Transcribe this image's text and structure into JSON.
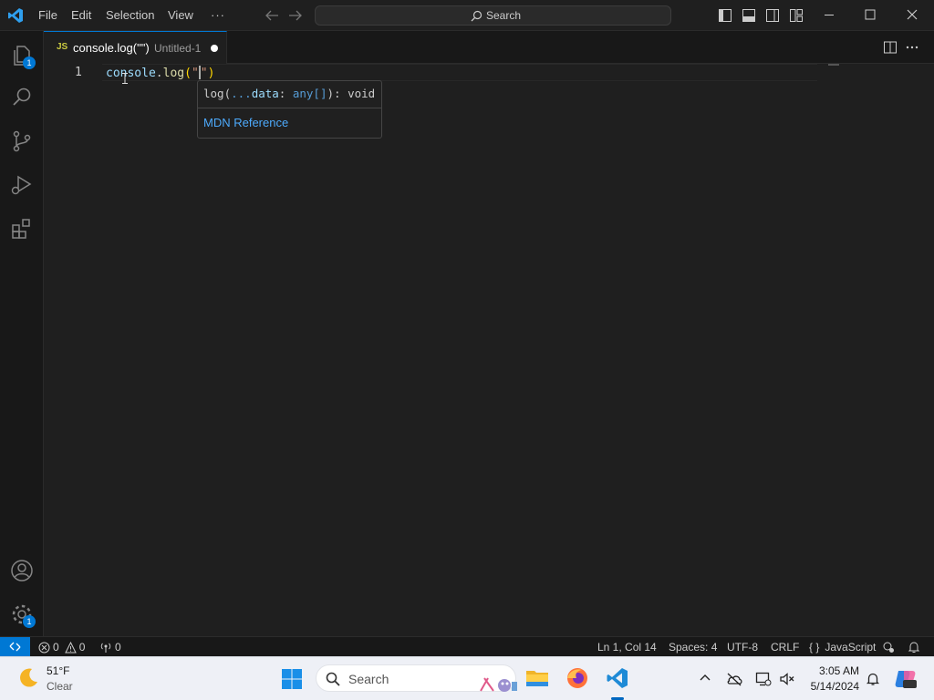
{
  "titlebar": {
    "menus": [
      "File",
      "Edit",
      "Selection",
      "View"
    ],
    "overflow": "···",
    "search_label": "Search"
  },
  "activitybar": {
    "explorer_badge": "1",
    "settings_badge": "1"
  },
  "tab": {
    "icon_label": "JS",
    "title": "console.log(\"\")",
    "description": "Untitled-1"
  },
  "editor": {
    "line_number": "1",
    "code": {
      "obj": "console",
      "dot": ".",
      "fn": "log",
      "open": "(",
      "q1": "\"",
      "q2": "\"",
      "close": ")"
    }
  },
  "hover": {
    "sig_name": "log(",
    "sig_dots": "...",
    "sig_param": "data",
    "sig_colon": ": ",
    "sig_type": "any[]",
    "sig_end": "): void",
    "link": "MDN Reference"
  },
  "statusbar": {
    "errors": "0",
    "warnings": "0",
    "ports": "0",
    "position": "Ln 1, Col 14",
    "spaces": "Spaces: 4",
    "encoding": "UTF-8",
    "eol": "CRLF",
    "language_braces": "{ }",
    "language": "JavaScript"
  },
  "taskbar": {
    "weather_temp": "51°F",
    "weather_cond": "Clear",
    "search_label": "Search",
    "time": "3:05 AM",
    "date": "5/14/2024"
  },
  "colors": {
    "accent": "#0078d4",
    "editor_bg": "#1f1f1f",
    "link": "#4daafc"
  }
}
